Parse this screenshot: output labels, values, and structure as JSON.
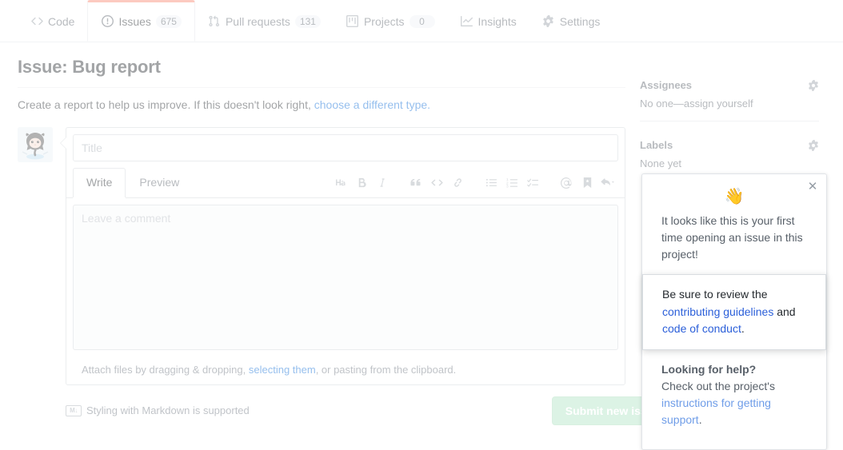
{
  "nav": {
    "items": [
      {
        "label": "Code",
        "icon": "code-icon",
        "count": null,
        "selected": false
      },
      {
        "label": "Issues",
        "icon": "issue-opened-icon",
        "count": "675",
        "selected": true
      },
      {
        "label": "Pull requests",
        "icon": "git-pull-request-icon",
        "count": "131",
        "selected": false
      },
      {
        "label": "Projects",
        "icon": "project-icon",
        "count": "0",
        "selected": false
      },
      {
        "label": "Insights",
        "icon": "graph-icon",
        "count": null,
        "selected": false
      },
      {
        "label": "Settings",
        "icon": "gear-icon",
        "count": null,
        "selected": false
      }
    ]
  },
  "header": {
    "title": "Issue: Bug report",
    "subtitle_text": "Create a report to help us improve. If this doesn't look right, ",
    "subtitle_link": "choose a different type."
  },
  "form": {
    "title_placeholder": "Title",
    "title_value": "",
    "write_tab": "Write",
    "preview_tab": "Preview",
    "comment_placeholder": "Leave a comment",
    "comment_value": "",
    "toolbar": [
      {
        "name": "heading-icon",
        "glyph": "AA"
      },
      {
        "name": "bold-icon",
        "glyph": "B"
      },
      {
        "name": "italic-icon",
        "glyph": "i"
      },
      {
        "name": "quote-icon",
        "glyph": "“"
      },
      {
        "name": "code-icon",
        "glyph": "<>"
      },
      {
        "name": "link-icon",
        "glyph": "ὑ7"
      },
      {
        "name": "unordered-list-icon",
        "glyph": "list"
      },
      {
        "name": "ordered-list-icon",
        "glyph": "123"
      },
      {
        "name": "task-list-icon",
        "glyph": "check"
      },
      {
        "name": "mention-icon",
        "glyph": "@"
      },
      {
        "name": "saved-reply-icon",
        "glyph": "bookmark"
      },
      {
        "name": "reply-icon",
        "glyph": "reply"
      }
    ],
    "attach_text_before": "Attach files by dragging & dropping, ",
    "attach_link": "selecting them",
    "attach_text_after": ", or pasting from the clipboard.",
    "markdown_note": "Styling with Markdown is supported",
    "markdown_badge": "M↓",
    "submit_label": "Submit new issue"
  },
  "sidebar": {
    "assignees_title": "Assignees",
    "assignees_value": "No one—assign yourself",
    "labels_title": "Labels",
    "labels_value": "None yet"
  },
  "popup": {
    "close_glyph": "✕",
    "emoji": "👋",
    "intro": "It looks like this is your first time opening an issue in this project!",
    "highlight_before": "Be sure to review the ",
    "highlight_link1": "contributing guidelines",
    "highlight_mid": " and ",
    "highlight_link2": "code of conduct",
    "highlight_after": ".",
    "foot_title": "Looking for help?",
    "foot_text": "Check out the project's ",
    "foot_link": "instructions for getting support",
    "foot_after": "."
  },
  "colors": {
    "accent_orange": "#f9826c",
    "link_blue": "#0366d6",
    "highlight_link_blue": "#2b5fd9",
    "submit_green": "#aee3c2",
    "border": "#e1e4e8"
  }
}
